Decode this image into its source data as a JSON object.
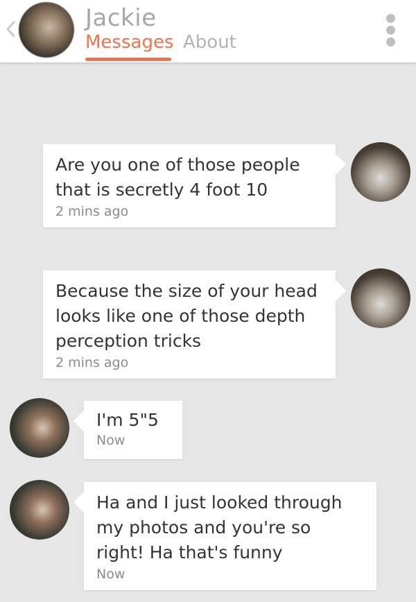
{
  "header": {
    "back_icon": "chevron-left-icon",
    "name": "Jackie",
    "tabs": [
      {
        "label": "Messages",
        "active": true
      },
      {
        "label": "About",
        "active": false
      }
    ],
    "menu_icon": "more-vertical-icon",
    "accent_color": "#f2724d"
  },
  "messages": [
    {
      "text": "Are you one of those people that is secretly 4 foot 10",
      "time": "2 mins ago",
      "from": "me"
    },
    {
      "text": "Because the size of your head looks like one of those depth perception tricks",
      "time": "2 mins ago",
      "from": "me"
    },
    {
      "text": "I'm 5\"5",
      "time": "Now",
      "from": "them"
    },
    {
      "text": "Ha and I just looked through my photos and you're so right! Ha that's funny",
      "time": "Now",
      "from": "them"
    }
  ]
}
